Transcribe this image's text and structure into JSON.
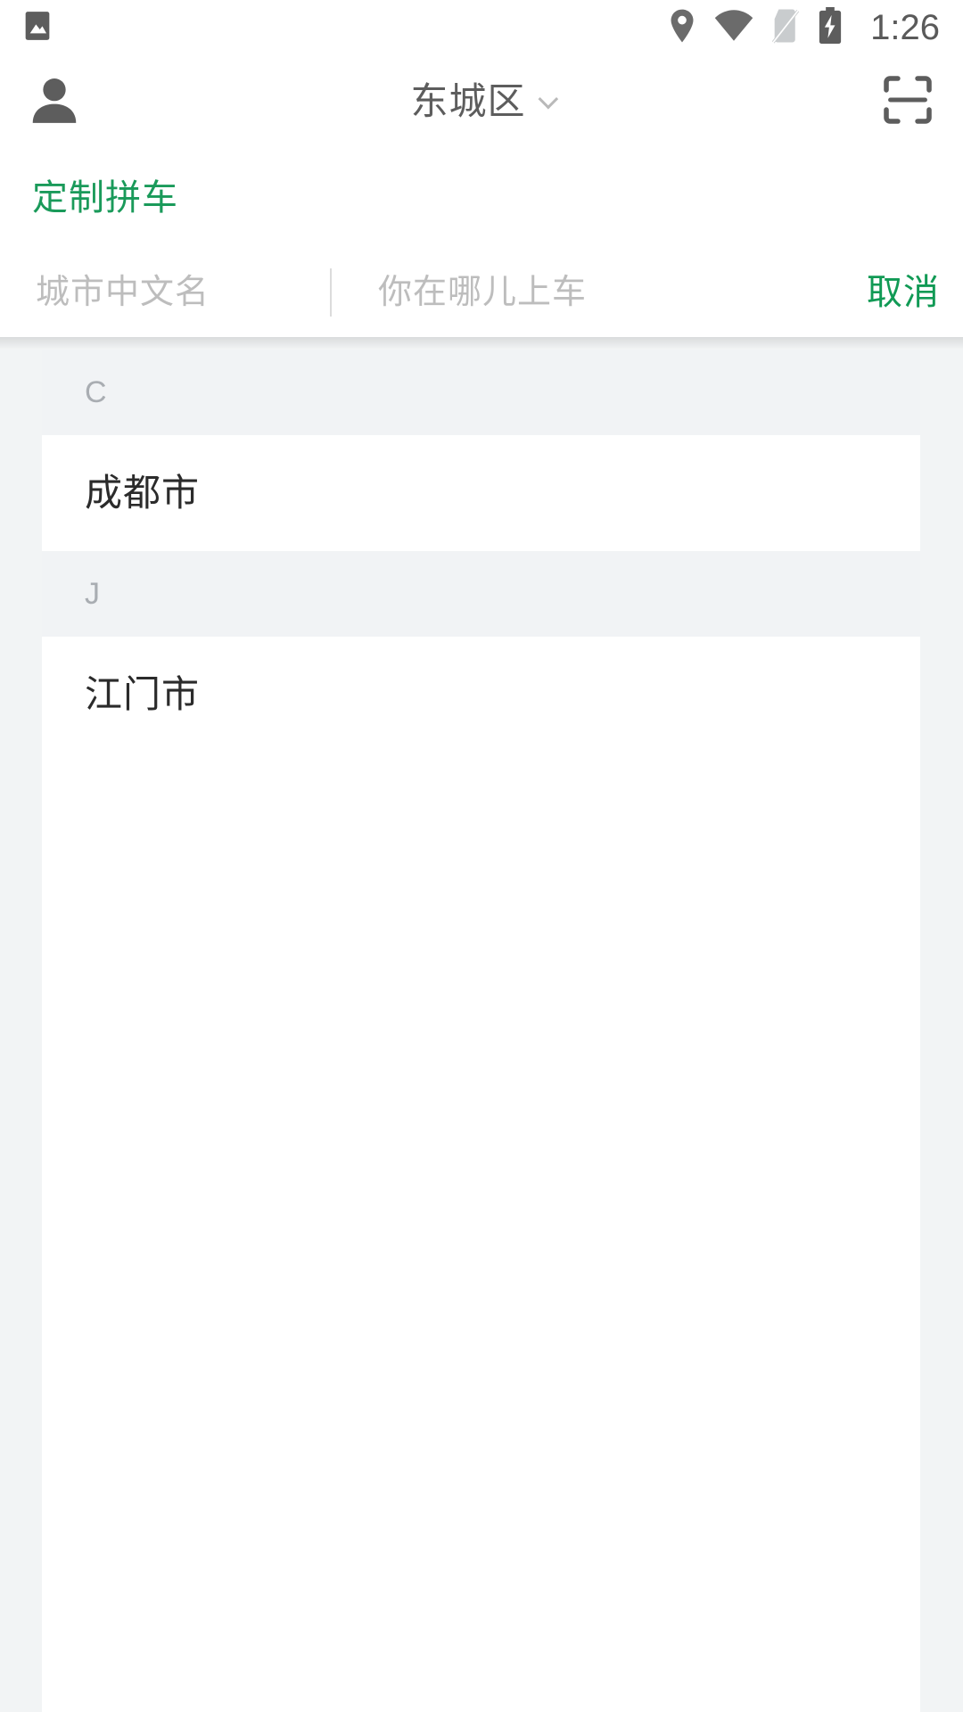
{
  "statusbar": {
    "time": "1:26",
    "left_icons": [
      {
        "name": "image-icon"
      }
    ],
    "right_icons": [
      {
        "name": "location-pin-icon"
      },
      {
        "name": "wifi-icon"
      },
      {
        "name": "no-sim-icon"
      },
      {
        "name": "battery-charging-icon"
      }
    ]
  },
  "header": {
    "profile_icon": "person-icon",
    "title": "东城区",
    "dropdown_icon": "chevron-down-icon",
    "scan_icon": "scan-qr-icon"
  },
  "tabs": [
    {
      "label": "定制拼车",
      "active": true
    }
  ],
  "search": {
    "city_value": "",
    "city_placeholder": "城市中文名",
    "pickup_value": "",
    "pickup_placeholder": "你在哪儿上车",
    "cancel_label": "取消"
  },
  "city_list": [
    {
      "letter": "C",
      "cities": [
        "成都市"
      ]
    },
    {
      "letter": "J",
      "cities": [
        "江门市"
      ]
    }
  ],
  "colors": {
    "accent_green": "#119a55",
    "tab_green": "#1a9a5a",
    "placeholder_grey": "#bdbdbd",
    "section_bg": "#f1f3f5",
    "page_bg": "#f2f4f5",
    "title_grey": "#5d5d5d",
    "city_text": "#2b2b2b"
  }
}
